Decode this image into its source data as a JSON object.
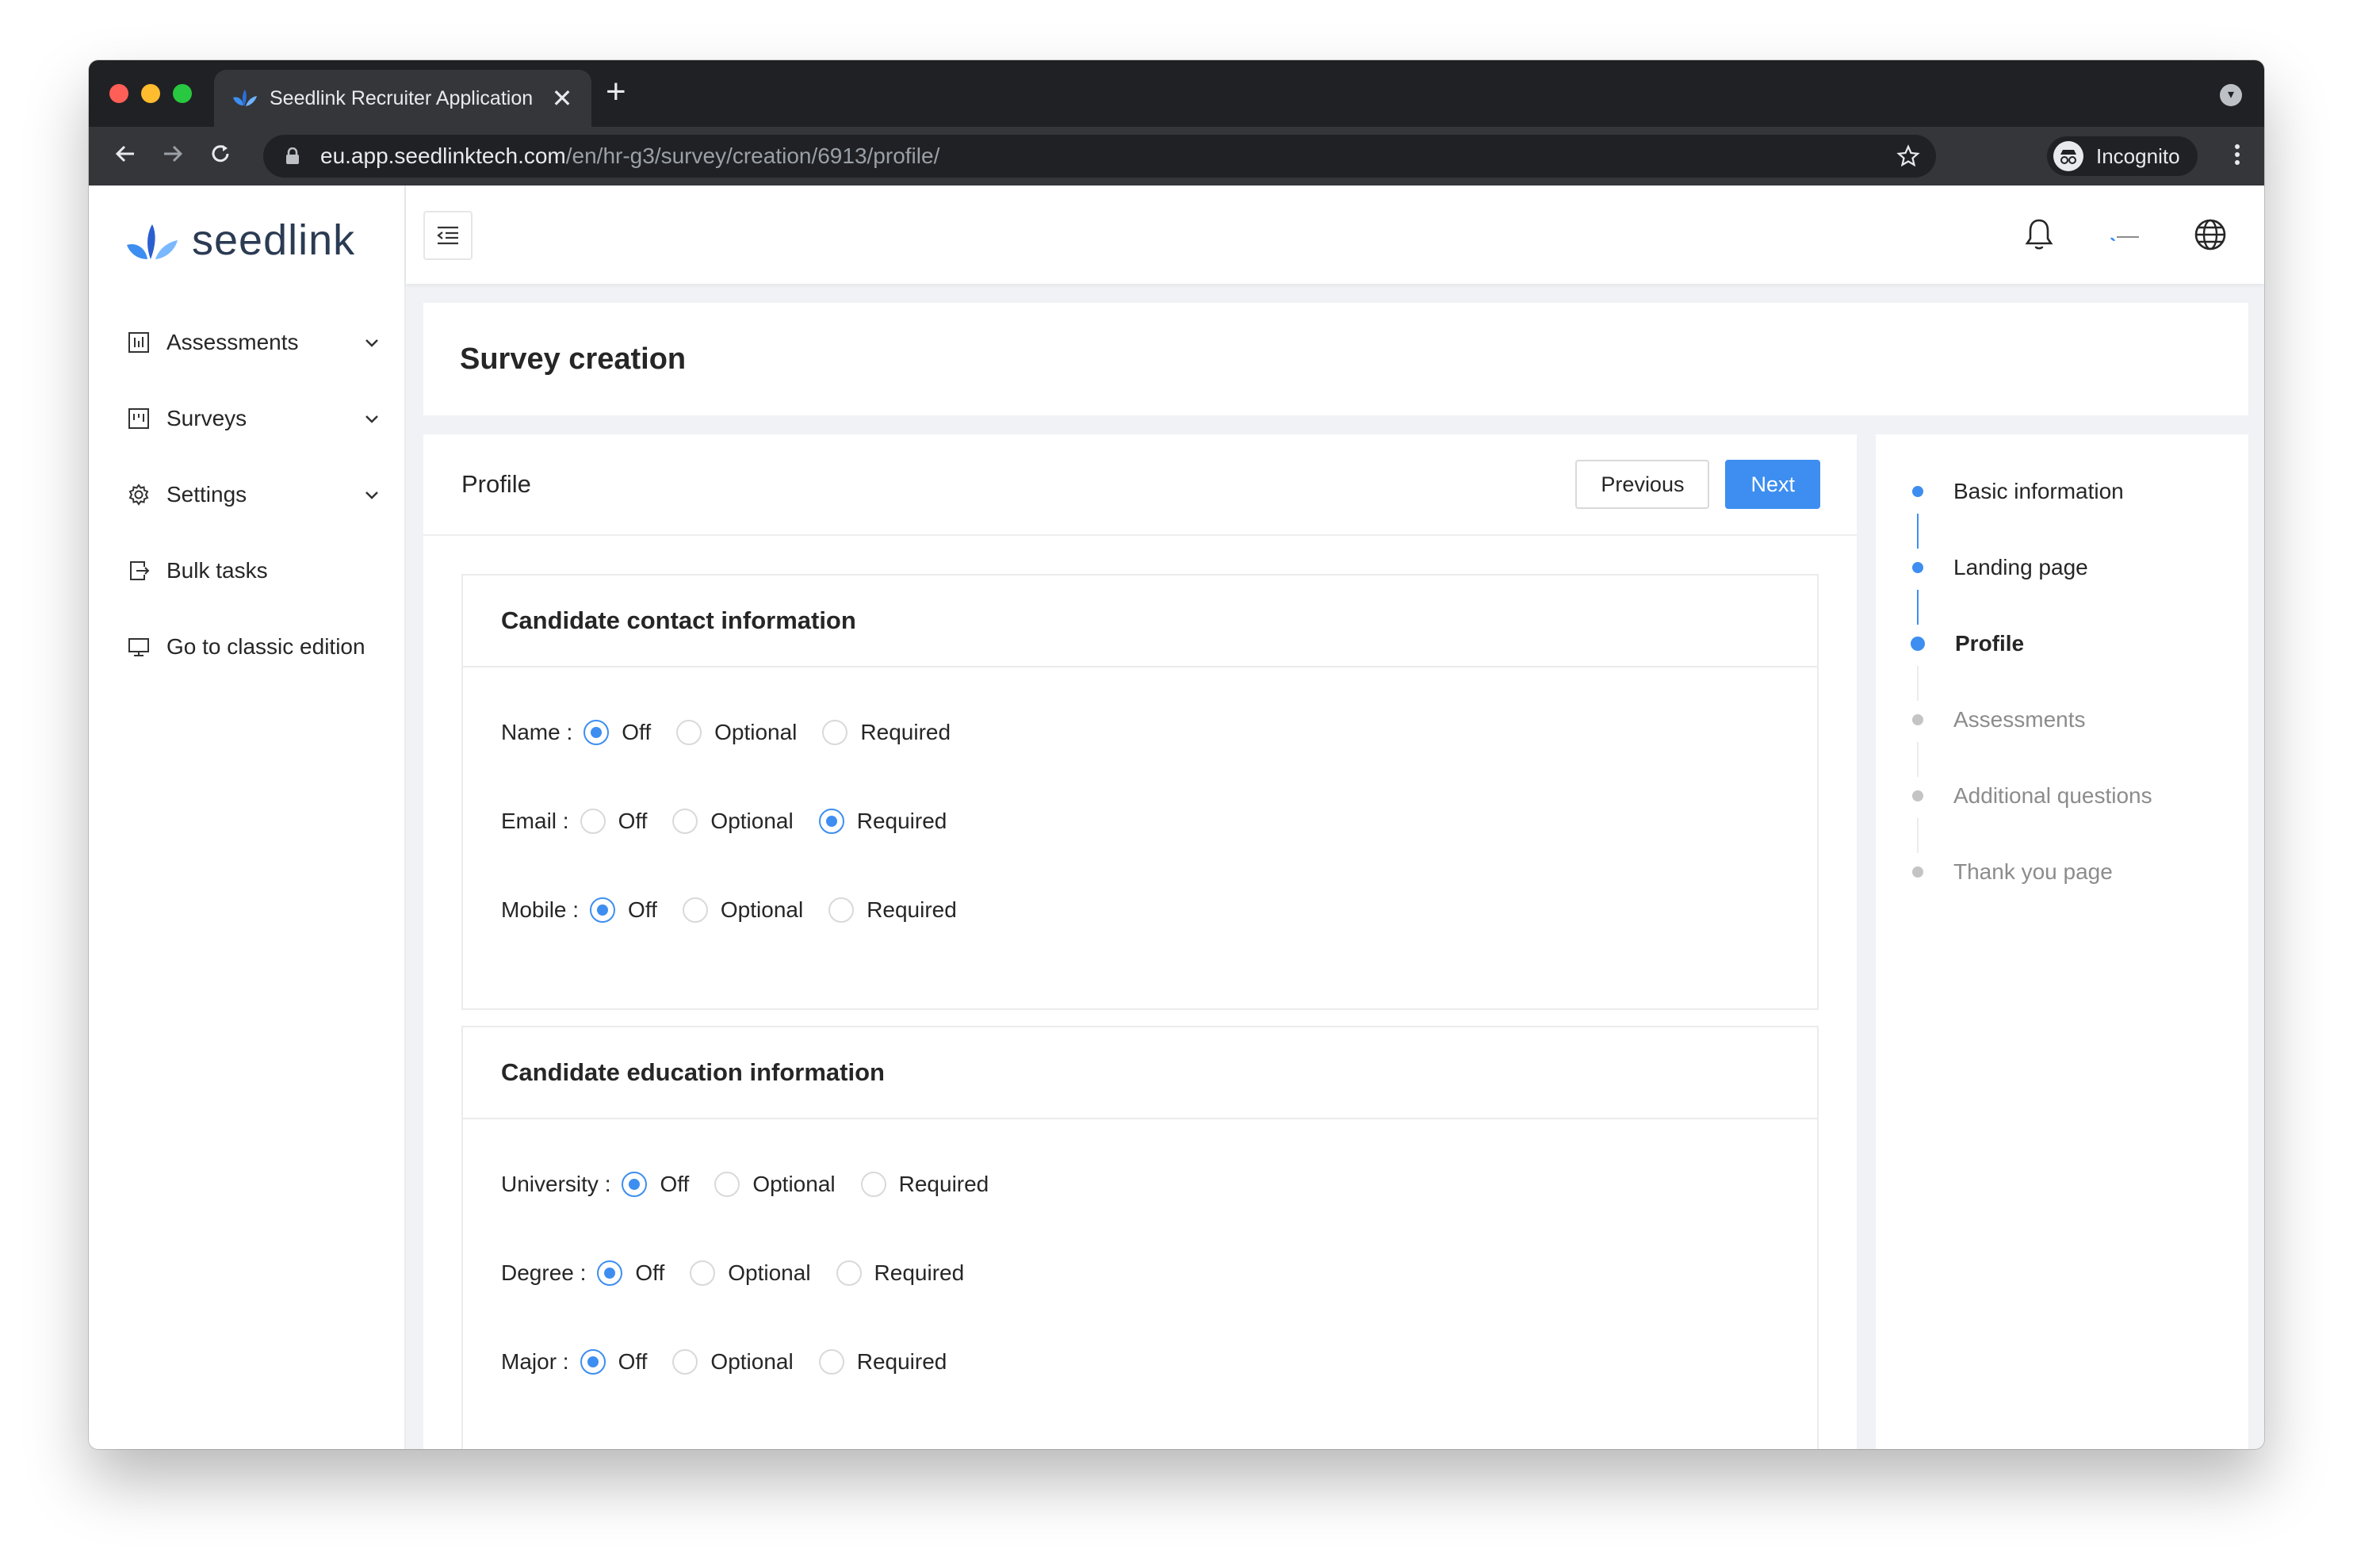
{
  "browser": {
    "tab_title": "Seedlink Recruiter Application",
    "tab_close": "✕",
    "new_tab": "+",
    "url_host": "eu.app.seedlinktech.com",
    "url_path": "/en/hr-g3/survey/creation/6913/profile/",
    "incognito_label": "Incognito"
  },
  "app": {
    "brand": "seedlink",
    "brand_color": "#2b3b53",
    "accent_color": "#3d8ef0"
  },
  "sidebar": {
    "items": [
      {
        "label": "Assessments",
        "icon": "assessments-icon",
        "expandable": true
      },
      {
        "label": "Surveys",
        "icon": "surveys-icon",
        "expandable": true
      },
      {
        "label": "Settings",
        "icon": "gear-icon",
        "expandable": true
      },
      {
        "label": "Bulk tasks",
        "icon": "bulk-tasks-icon",
        "expandable": false
      },
      {
        "label": "Go to classic edition",
        "icon": "monitor-icon",
        "expandable": false
      }
    ]
  },
  "page": {
    "title": "Survey creation"
  },
  "main": {
    "title": "Profile",
    "previous_label": "Previous",
    "next_label": "Next",
    "radio_options": [
      "Off",
      "Optional",
      "Required"
    ],
    "sections": [
      {
        "title": "Candidate contact information",
        "fields": [
          {
            "label": "Name",
            "selected": "Off"
          },
          {
            "label": "Email",
            "selected": "Required"
          },
          {
            "label": "Mobile",
            "selected": "Off"
          }
        ]
      },
      {
        "title": "Candidate education information",
        "fields": [
          {
            "label": "University",
            "selected": "Off"
          },
          {
            "label": "Degree",
            "selected": "Off"
          },
          {
            "label": "Major",
            "selected": "Off"
          }
        ]
      }
    ]
  },
  "steps": {
    "items": [
      {
        "label": "Basic information",
        "status": "done"
      },
      {
        "label": "Landing page",
        "status": "done"
      },
      {
        "label": "Profile",
        "status": "current"
      },
      {
        "label": "Assessments",
        "status": "todo"
      },
      {
        "label": "Additional questions",
        "status": "todo"
      },
      {
        "label": "Thank you page",
        "status": "todo"
      }
    ]
  }
}
